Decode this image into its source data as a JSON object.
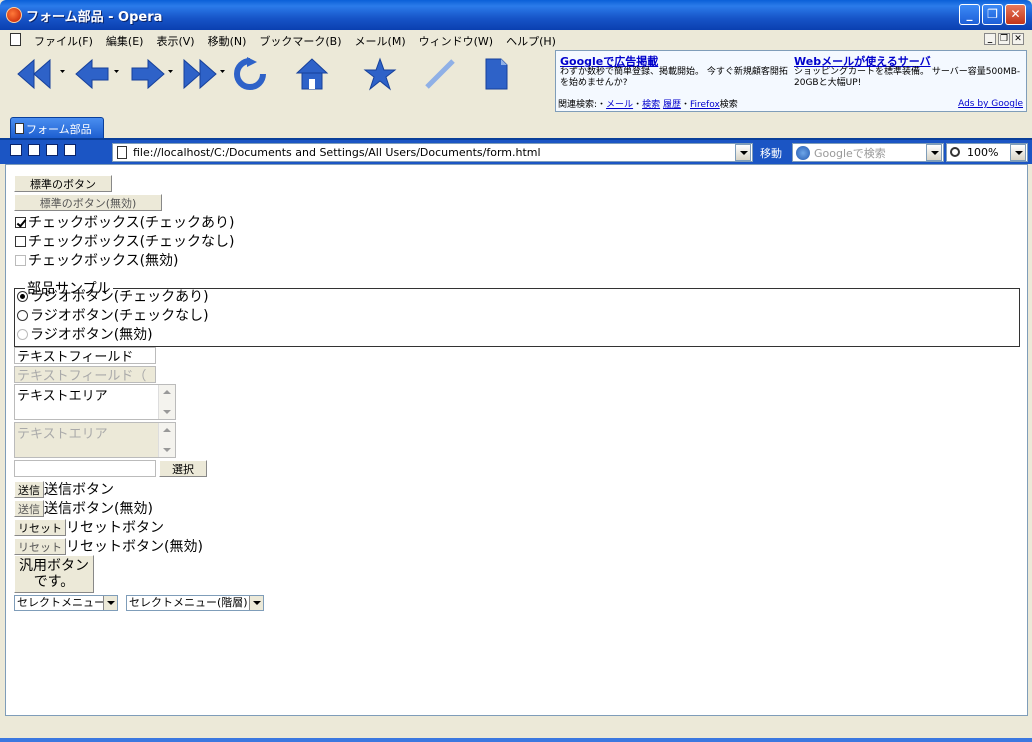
{
  "window": {
    "title": "フォーム部品 - Opera"
  },
  "menu": [
    "ファイル(F)",
    "編集(E)",
    "表示(V)",
    "移動(N)",
    "ブックマーク(B)",
    "メール(M)",
    "ウィンドウ(W)",
    "ヘルプ(H)"
  ],
  "ad": {
    "h1": "Googleで広告掲載",
    "t1": "わずか数秒で簡単登録、掲載開始。 今すぐ新規顧客開拓を始めませんか?",
    "h2": "Webメールが使えるサーバ",
    "t2": "ショッピングカートを標準装備。 サーバー容量500MB-20GBと大幅UP!",
    "related_prefix": "関連検索:・",
    "related_1": "メール",
    "related_sep1": "・",
    "related_2": "検索",
    "related_3": "履歴",
    "related_sep2": "・",
    "related_4": "Firefox",
    "related_suffix": "検索",
    "ads_by": "Ads by Google"
  },
  "tab": {
    "label": "フォーム部品"
  },
  "address": {
    "url": "file://localhost/C:/Documents and Settings/All Users/Documents/form.html",
    "goto_label": "移動",
    "search_placeholder": "Googleで検索",
    "zoom": "100%"
  },
  "form": {
    "std_button": "標準のボタン",
    "std_button_disabled": "標準のボタン(無効)",
    "checkbox_checked": "チェックボックス(チェックあり)",
    "checkbox_unchecked": "チェックボックス(チェックなし)",
    "checkbox_disabled": "チェックボックス(無効)",
    "fieldset_legend": "部品サンプル",
    "radio_checked": "ラジオボタン(チェックあり)",
    "radio_unchecked": "ラジオボタン(チェックなし)",
    "radio_disabled": "ラジオボタン(無効)",
    "textfield_value": "テキストフィールド",
    "textfield_disabled_value": "テキストフィールド（",
    "textarea_value": "テキストエリア",
    "textarea_disabled_value": "テキストエリア",
    "file_button": "選択",
    "submit_btn": "送信",
    "submit_label": "送信ボタン",
    "submit_disabled_btn": "送信",
    "submit_disabled_label": "送信ボタン(無効)",
    "reset_btn": "リセット",
    "reset_label": "リセットボタン",
    "reset_disabled_btn": "リセット",
    "reset_disabled_label": "リセットボタン(無効)",
    "generic_button_line1": "汎用ボタン",
    "generic_button_line2": "です。",
    "select1": "セレクトメニュー",
    "select2": "セレクトメニュー(階層)"
  }
}
